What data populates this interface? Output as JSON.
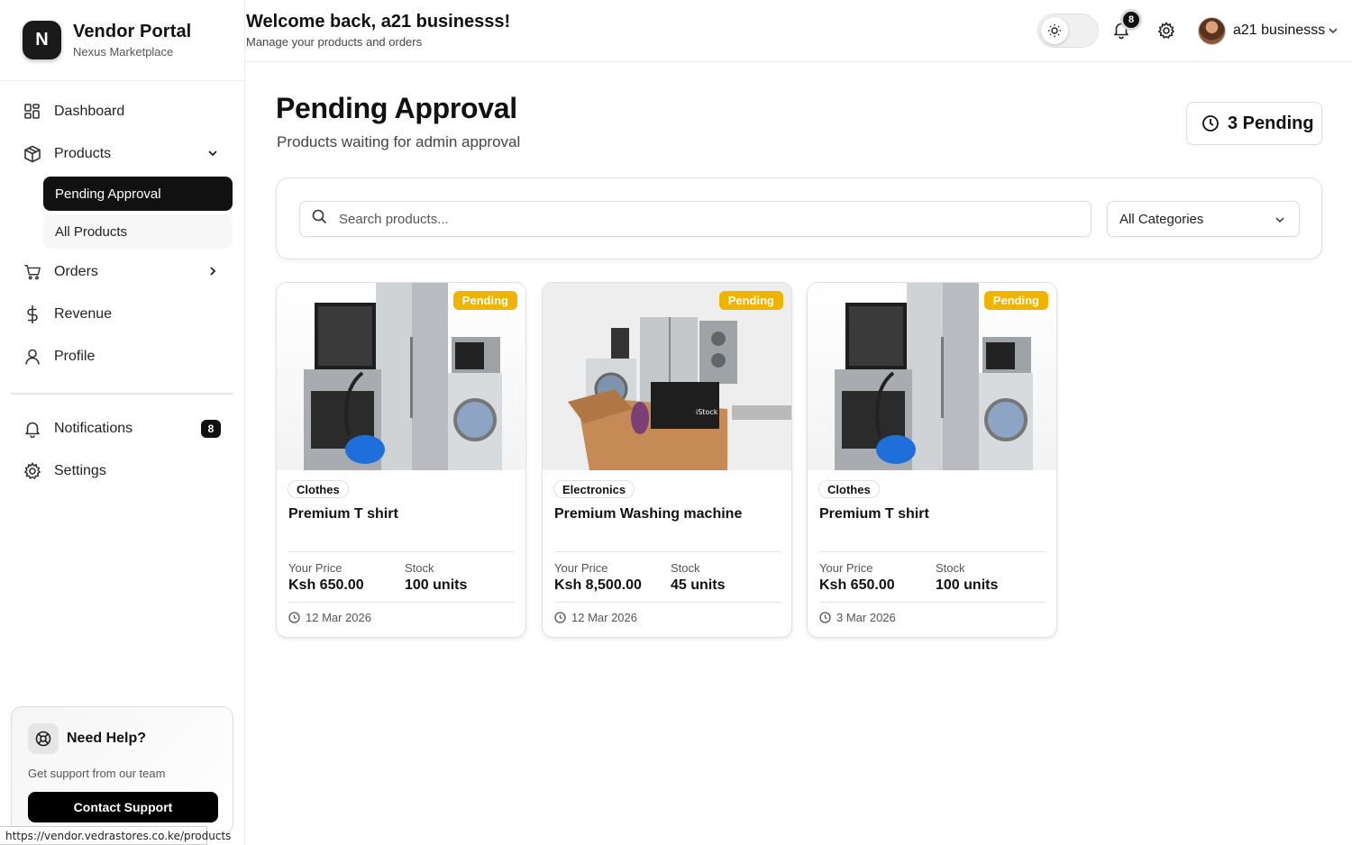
{
  "brand": {
    "logo_letter": "N",
    "name": "Vendor Portal",
    "subtitle": "Nexus Marketplace"
  },
  "sidebar": {
    "items": [
      {
        "label": "Dashboard",
        "icon": "grid-icon"
      },
      {
        "label": "Products",
        "icon": "package-icon",
        "expanded": true,
        "children": [
          {
            "label": "Pending Approval",
            "active": true
          },
          {
            "label": "All Products"
          }
        ]
      },
      {
        "label": "Orders",
        "icon": "cart-icon"
      },
      {
        "label": "Revenue",
        "icon": "dollar-icon"
      },
      {
        "label": "Profile",
        "icon": "user-icon"
      }
    ],
    "secondary": [
      {
        "label": "Notifications",
        "icon": "bell-icon",
        "badge": "8"
      },
      {
        "label": "Settings",
        "icon": "gear-icon"
      }
    ]
  },
  "help": {
    "title": "Need Help?",
    "subtitle": "Get support from our team",
    "button": "Contact Support"
  },
  "status_url": "https://vendor.vedrastores.co.ke/products",
  "header": {
    "welcome": "Welcome back, a21 businesss!",
    "subtitle": "Manage your products and orders",
    "notif_count": "8",
    "user_name": "a21 businesss"
  },
  "page": {
    "title": "Pending Approval",
    "subtitle": "Products waiting for admin approval",
    "pending_label": "3 Pending"
  },
  "filters": {
    "search_placeholder": "Search products...",
    "category": "All Categories"
  },
  "labels": {
    "price": "Your Price",
    "stock": "Stock"
  },
  "products": [
    {
      "status": "Pending",
      "category": "Clothes",
      "name": "Premium T shirt",
      "price": "Ksh 650.00",
      "stock": "100 units",
      "date": "12 Mar 2026"
    },
    {
      "status": "Pending",
      "category": "Electronics",
      "name": "Premium Washing machine",
      "price": "Ksh 8,500.00",
      "stock": "45 units",
      "date": "12 Mar 2026"
    },
    {
      "status": "Pending",
      "category": "Clothes",
      "name": "Premium T shirt",
      "price": "Ksh 650.00",
      "stock": "100 units",
      "date": "3 Mar 2026"
    }
  ],
  "colors": {
    "accent": "#111111",
    "pending": "#f0b400"
  }
}
